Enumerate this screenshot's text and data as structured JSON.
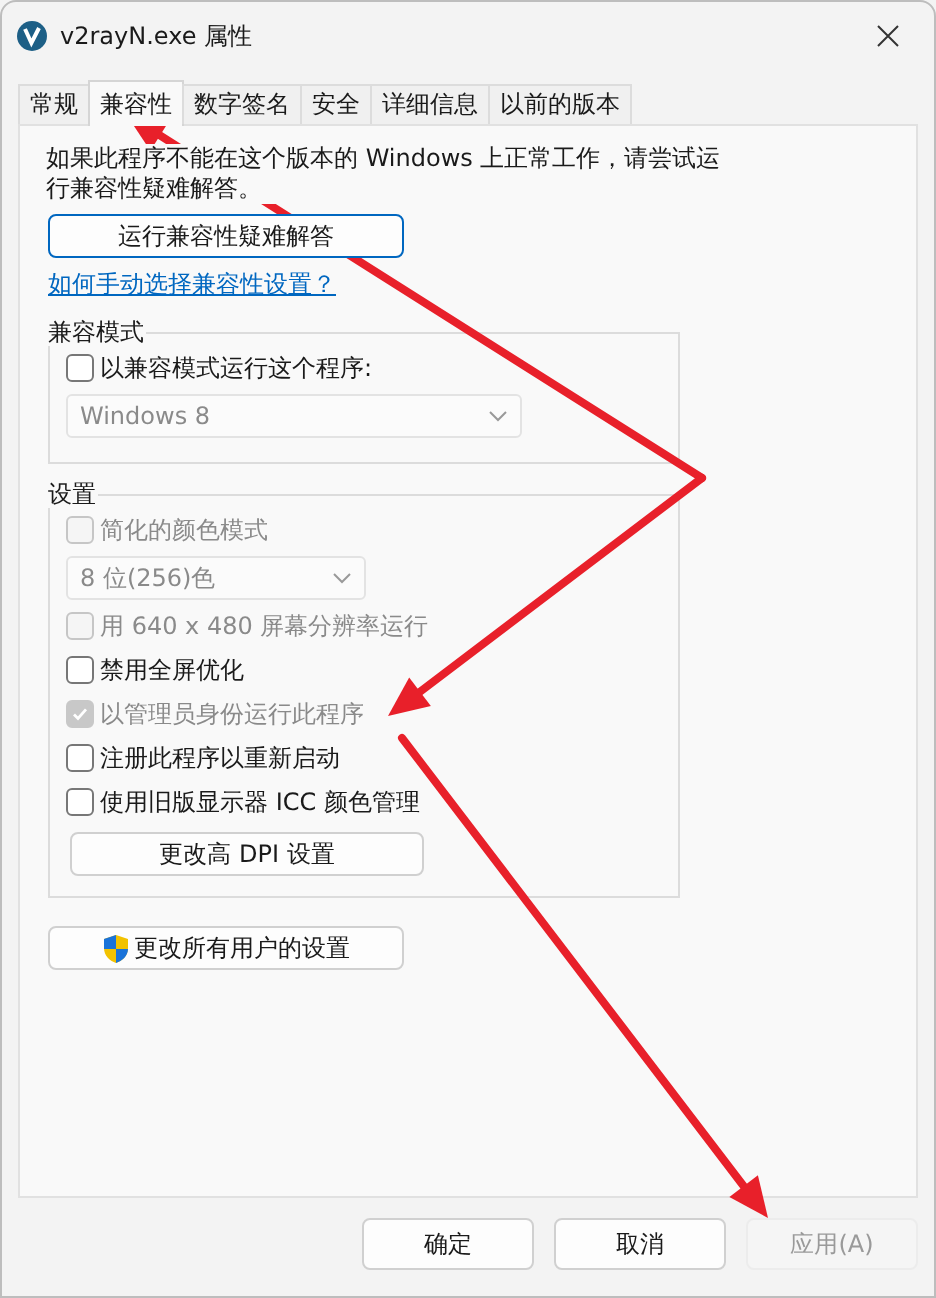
{
  "window": {
    "title": "v2rayN.exe 属性"
  },
  "tabs": [
    {
      "label": "常规",
      "selected": false
    },
    {
      "label": "兼容性",
      "selected": true
    },
    {
      "label": "数字签名",
      "selected": false
    },
    {
      "label": "安全",
      "selected": false
    },
    {
      "label": "详细信息",
      "selected": false
    },
    {
      "label": "以前的版本",
      "selected": false
    }
  ],
  "intro": {
    "text": "如果此程序不能在这个版本的 Windows 上正常工作，请尝试运行兼容性疑难解答。",
    "troubleshoot_button": "运行兼容性疑难解答",
    "help_link": "如何手动选择兼容性设置？"
  },
  "compat_mode": {
    "label": "兼容模式",
    "items": [
      {
        "kind": "checkbox",
        "label": "以兼容模式运行这个程序:",
        "checked": false,
        "disabled": false
      },
      {
        "kind": "dropdown",
        "value": "Windows 8",
        "disabled": true
      }
    ]
  },
  "settings": {
    "label": "设置",
    "items": [
      {
        "kind": "checkbox",
        "label": "简化的颜色模式",
        "checked": false,
        "disabled": true
      },
      {
        "kind": "dropdown",
        "value": "8 位(256)色",
        "disabled": true
      },
      {
        "kind": "checkbox",
        "label": "用 640 x 480 屏幕分辨率运行",
        "checked": false,
        "disabled": true
      },
      {
        "kind": "checkbox",
        "label": "禁用全屏优化",
        "checked": false,
        "disabled": false
      },
      {
        "kind": "checkbox",
        "label": "以管理员身份运行此程序",
        "checked": true,
        "disabled": true
      },
      {
        "kind": "checkbox",
        "label": "注册此程序以重新启动",
        "checked": false,
        "disabled": false
      },
      {
        "kind": "checkbox",
        "label": "使用旧版显示器 ICC 颜色管理",
        "checked": false,
        "disabled": false
      },
      {
        "kind": "button",
        "label": "更改高 DPI 设置"
      }
    ]
  },
  "all_users_button": {
    "label": "更改所有用户的设置"
  },
  "buttons": [
    {
      "label": "确定",
      "disabled": false
    },
    {
      "label": "取消",
      "disabled": false
    },
    {
      "label": "应用(A)",
      "disabled": true
    }
  ]
}
